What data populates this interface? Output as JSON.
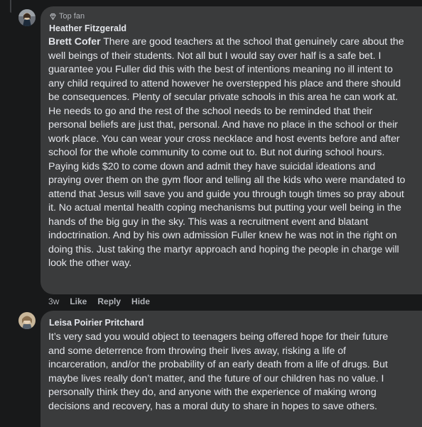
{
  "comments": [
    {
      "badge": "Top fan",
      "author": "Heather Fitzgerald",
      "mention": "Brett Cofer",
      "text": "There are good teachers at the school that genuinely care about the well beings of their students. Not all but I would say over half is a safe bet. I guarantee you Fuller did this with the best of intentions meaning no ill intent to any child required to attend however he overstepped his place and there should be consequences. Plenty of secular private schools in this area he can work at. He needs to go and the rest of the school needs to be reminded that their personal beliefs are just that, personal. And have no place in the school or their work place. You can wear your cross necklace and host events before and after school for the whole community to come out to. But not during school hours. Paying kids $20 to come down and admit they have suicidal ideations and praying over them on the gym floor and telling all the kids who were mandated to attend that Jesus will save you and guide you through tough times so pray about it. No actual mental health coping mechanisms but putting your well being in the hands of the big guy in the sky. This was a recruitment event and blatant indoctrination. And by his own admission Fuller knew he was not in the right on doing this. Just taking the martyr approach and hoping the people in charge will look the other way.",
      "time": "3w",
      "actions": [
        "Like",
        "Reply",
        "Hide"
      ]
    },
    {
      "author": "Leisa Poirier Pritchard",
      "text": "It’s very sad you would object to teenagers being offered hope for their future and some deterrence from throwing their lives away, risking a life of incarceration, and/or the probability of an early death from a life of drugs. But maybe lives really don’t matter, and the future of our children has no value. I personally think they do, and anyone with the experience of making wrong decisions and recovery, has a moral duty to share in hopes to save others."
    }
  ],
  "colors": {
    "background": "#18191a",
    "bubble": "#3a3b3c",
    "text": "#e4e6eb",
    "muted": "#b0b3b8"
  },
  "icons": {
    "badge": "diamond-badge-icon"
  }
}
